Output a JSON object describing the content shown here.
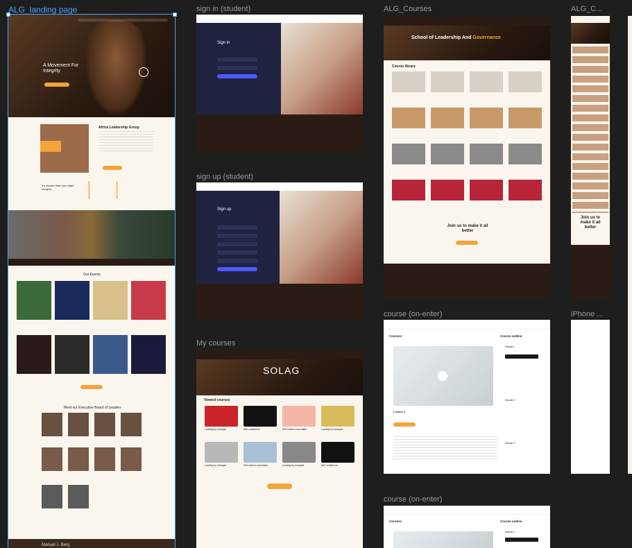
{
  "frames": {
    "landing": {
      "label": "ALG_landing page",
      "hero_title": "A Movement For Integrity",
      "about_title": "Africa Leadership Group",
      "simpler": "It's simpler than you might imagine...",
      "events_title": "Our Events",
      "board_title": "Meet our Executive Board of Leaders",
      "bottom_name": "Manuel J. Berg"
    },
    "signin": {
      "label": "sign in (student)",
      "heading": "Sign in",
      "button": "Sign in"
    },
    "signup": {
      "label": "sign up (student)",
      "heading": "Sign up",
      "button": "Sign up"
    },
    "mycourses": {
      "label": "My courses",
      "hero": "SOLAG",
      "section": "Viewed courses",
      "courses": [
        "Loading by example",
        "Self confidence",
        "Self esteem essentials",
        "Leading by example",
        "Loading by example",
        "Self esteem essentials",
        "Leading by example",
        "Self confidence"
      ]
    },
    "courses": {
      "label": "ALG_Courses",
      "hero_main": "School of Leadership And ",
      "hero_accent": "Governance",
      "library": "Course library",
      "cta": "Join us to make it all better"
    },
    "courses_small": {
      "label": "ALG_C...",
      "cta": "Join us to make it all better"
    },
    "enter1": {
      "label": "course (on-enter)",
      "crumb": "Courses",
      "outline": "Course outline",
      "lesson": "Lesson 1",
      "modules": [
        "Module 1",
        "Module 2",
        "Module 3"
      ]
    },
    "enter2": {
      "label": "course (on-enter)",
      "crumb": "Courses",
      "outline": "Course outline",
      "module": "Module 1"
    },
    "iphone": {
      "label": "iPhone ..."
    }
  },
  "colors": {
    "accent": "#f2a43a",
    "navy": "#1f2340",
    "dark": "#2a1c14",
    "select": "#4aa3ff"
  }
}
